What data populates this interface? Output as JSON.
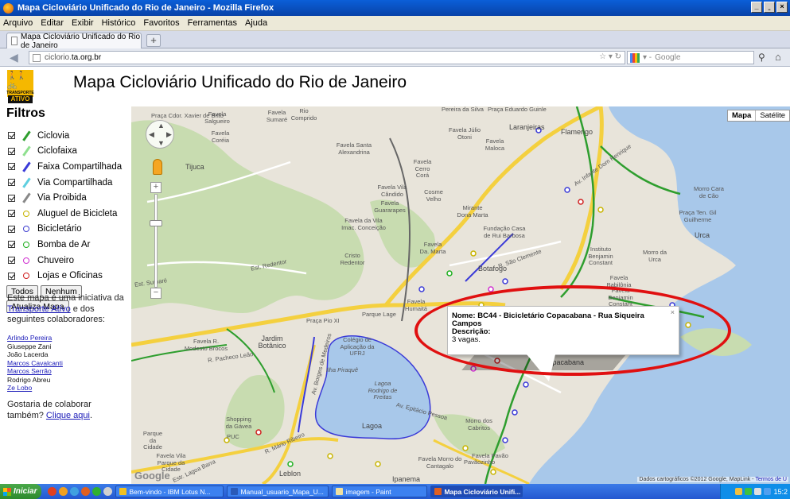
{
  "window": {
    "title": "Mapa Cicloviário Unificado do Rio de Janeiro - Mozilla Firefox",
    "controls": [
      "_",
      "̱",
      "×"
    ]
  },
  "menubar": [
    "Arquivo",
    "Editar",
    "Exibir",
    "Histórico",
    "Favoritos",
    "Ferramentas",
    "Ajuda"
  ],
  "tab": {
    "label": "Mapa Cicloviário Unificado do Rio de Janeiro",
    "new_tab": "+"
  },
  "navbar": {
    "url_prefix": "ciclorio.",
    "url_host": "ta.org.br",
    "search_placeholder": "Google",
    "icons": [
      "back-icon",
      "site-icon",
      "star-icon",
      "reload-icon",
      "google-icon",
      "search-icon",
      "home-icon"
    ]
  },
  "page": {
    "logo_top": "TRANSPORTE",
    "logo_bottom": "ATIVO",
    "title": "Mapa Cicloviário Unificado do Rio de Janeiro"
  },
  "filters": {
    "heading": "Filtros",
    "items": [
      {
        "label": "Ciclovia",
        "kind": "line",
        "color": "#2e9e2e"
      },
      {
        "label": "Ciclofaixa",
        "kind": "line",
        "color": "#8fe08f"
      },
      {
        "label": "Faixa Compartilhada",
        "kind": "line",
        "color": "#3a3ad8"
      },
      {
        "label": "Via Compartilhada",
        "kind": "line",
        "color": "#5fcfe0"
      },
      {
        "label": "Via Proibida",
        "kind": "line",
        "color": "#888888"
      },
      {
        "label": "Aluguel de Bicicleta",
        "kind": "dot",
        "color": "#c8b400"
      },
      {
        "label": "Bicicletário",
        "kind": "dot",
        "color": "#4040d0"
      },
      {
        "label": "Bomba de Ar",
        "kind": "dot",
        "color": "#20b020"
      },
      {
        "label": "Chuveiro",
        "kind": "dot",
        "color": "#d030d0"
      },
      {
        "label": "Lojas e Oficinas",
        "kind": "dot",
        "color": "#d02020"
      }
    ],
    "btn_all": "Todos",
    "btn_none": "Nenhum",
    "btn_update": "Atualiza Mapa"
  },
  "info": {
    "text_before": "Este mapa é uma iniciativa da ",
    "link": "Transporte Ativo",
    "text_after": " e dos seguintes colaboradores:"
  },
  "collaborators": [
    {
      "name": "Arlindo Pereira",
      "link": true
    },
    {
      "name": "Giuseppe Zani",
      "link": false
    },
    {
      "name": "João Lacerda",
      "link": false
    },
    {
      "name": "Marcos Cavalcanti",
      "link": true
    },
    {
      "name": "Marcos Serrão",
      "link": true
    },
    {
      "name": "Rodrigo Abreu",
      "link": false
    },
    {
      "name": "Ze Lobo",
      "link": true
    }
  ],
  "cta": {
    "text": "Gostaria de colaborar também? ",
    "link": "Clique aqui",
    "suffix": "."
  },
  "map": {
    "type_map": "Mapa",
    "type_sat": "Satélite",
    "zoom_in": "+",
    "zoom_out": "−",
    "google": "Google",
    "attribution_text": "Dados cartográficos ©2012 Google, MapLink - ",
    "attribution_link": "Termos de U",
    "labels": [
      "Praça Cdor. Xavier de Brito",
      "Favela Salgueiro",
      "Favela Sumaré",
      "Rio Comprido",
      "Pereira da Silva",
      "Praça Eduardo Guinle",
      "Favela Coréia",
      "Favela Júlio Otoni",
      "Laranjeiras",
      "Flamengo",
      "Favela Santa Alexandrina",
      "Favela Maloca",
      "Tijuca",
      "Favela Cerro Corá",
      "Favela Vila Cândido",
      "Cosme Velho",
      "Favela Guararapes",
      "Mirante Dona Marta",
      "Fundação Casa de Rui Barbosa",
      "Morro Cara de Cão",
      "Praça Ten. Gil Guilherme",
      "Favela da Vila Imac. Conceição",
      "Urca",
      "Cristo Redentor",
      "Favela Da. Marta",
      "Instituto Benjamin Constant",
      "Morro da Urca",
      "Botafogo",
      "Favela Babilônia",
      "Favela Humaitá",
      "Parque Lage",
      "Praça Pio XI",
      "Favela Benjamin Constant",
      "Favela R. Modesto Brocos",
      "Jardim Botânico",
      "Colégio de Aplicação da UFRJ",
      "Ilha Piraquê",
      "Lagoa Rodrigo de Freitas",
      "Lagoa",
      "Shopping da Gávea",
      "PUC",
      "Morro dos Cabritos",
      "Parque da Cidade",
      "Favela Vila Parque da Cidade",
      "Leblon",
      "Favela Morro do Cantagalo",
      "Pavãozinho",
      "Favela Pavão",
      "Ipanema",
      "Copacabana"
    ],
    "streets": [
      "Est. Redentor",
      "Est. Sumaré",
      "R. São Clemente",
      "R. Pacheco Leão",
      "Av. Borges de Medeiros",
      "Av. Epitácio Pessoa",
      "R. Mário Ribeiro",
      "Estr. Lagoa Barra",
      "Av. Infante Dom Henrique"
    ]
  },
  "infowindow": {
    "title": "Nome: BC44 - Bicicletário Copacabana - Rua Siqueira Campos",
    "desc_label": "Descrição:",
    "desc": "3 vagas.",
    "close": "×"
  },
  "taskbar": {
    "start": "Iniciar",
    "tasks": [
      "Bem-vindo - IBM Lotus N...",
      "Manual_usuario_Mapa_U...",
      "imagem - Paint",
      "Mapa Cicloviário Unifi..."
    ],
    "clock": "15:2"
  }
}
